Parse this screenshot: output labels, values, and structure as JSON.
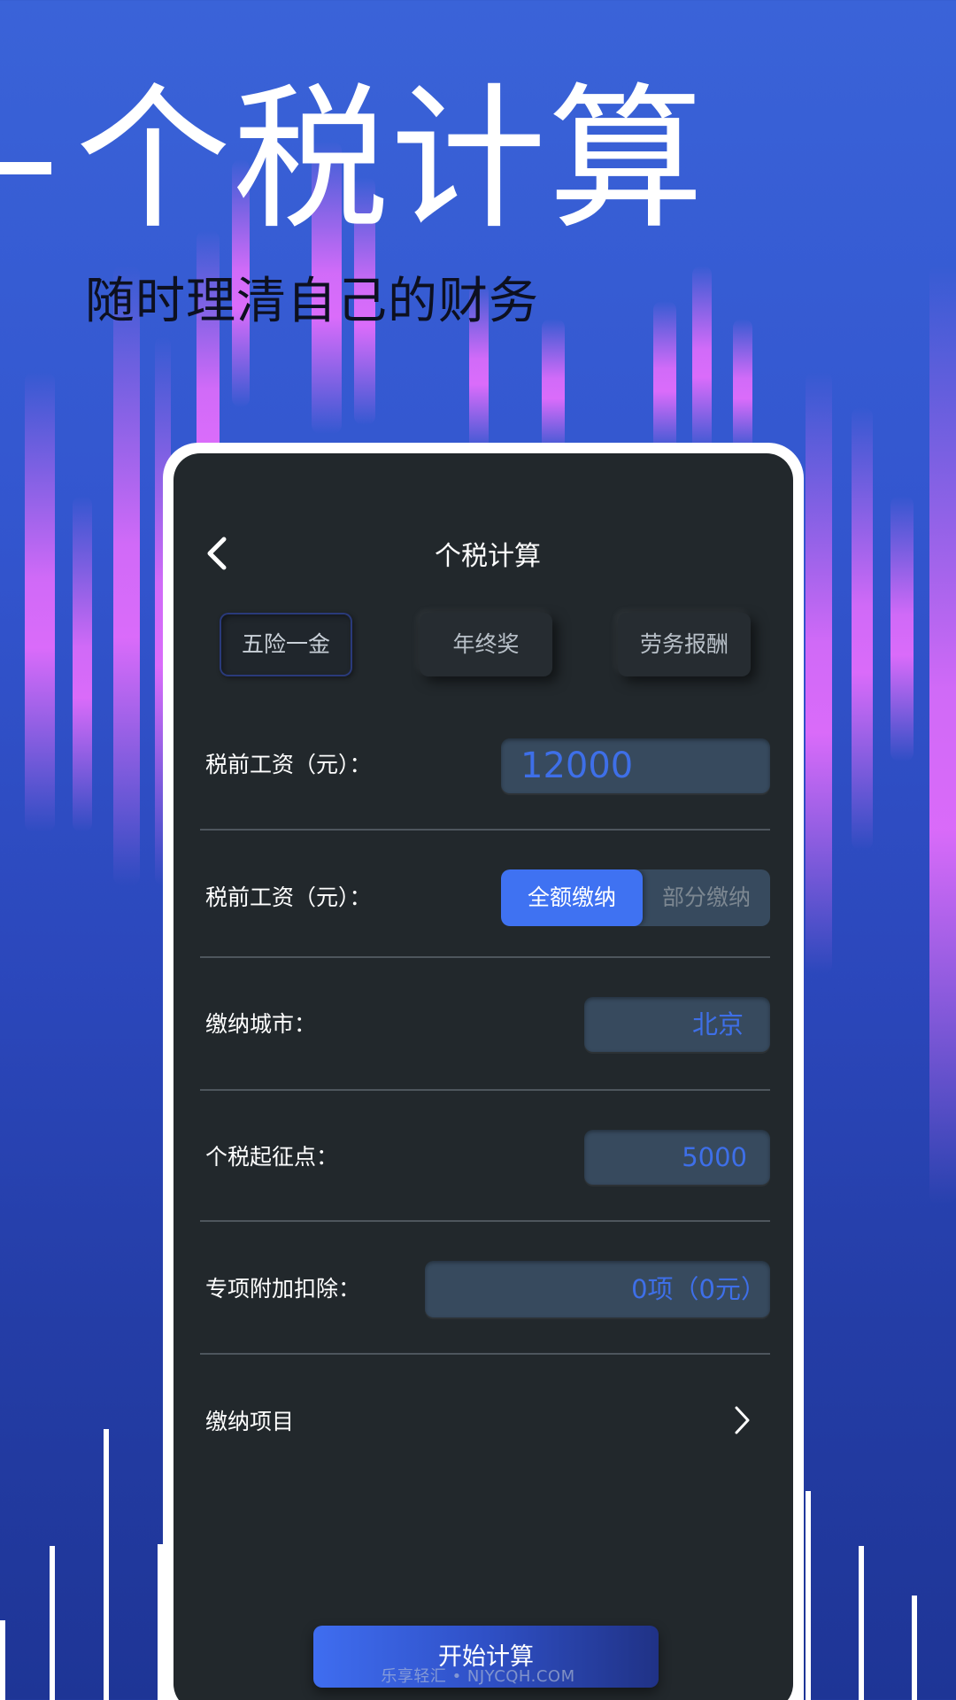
{
  "hero": {
    "title": "个税计算",
    "subtitle": "随时理清自己的财务"
  },
  "screen": {
    "title": "个税计算",
    "back_icon": "chevron-left-icon",
    "tabs": [
      {
        "label": "五险一金",
        "active": true
      },
      {
        "label": "年终奖",
        "active": false
      },
      {
        "label": "劳务报酬",
        "active": false
      }
    ],
    "rows": {
      "salary": {
        "label": "税前工资（元）：",
        "value": "12000"
      },
      "payment_mode": {
        "label": "税前工资（元）：",
        "options": [
          "全额缴纳",
          "部分缴纳"
        ],
        "selected": "全额缴纳"
      },
      "city": {
        "label": "缴纳城市：",
        "value": "北京"
      },
      "threshold": {
        "label": "个税起征点：",
        "value": "5000"
      },
      "special_deduction": {
        "label": "专项附加扣除：",
        "value": "0项（0元）"
      },
      "items": {
        "label": "缴纳项目",
        "icon": "chevron-right-icon"
      }
    },
    "start_button": "开始计算"
  },
  "watermark": "乐享轻汇 • NJYCQH.COM",
  "colors": {
    "background": "#3356cf",
    "accent": "#3f72f2",
    "glow": "#ec6eff",
    "screen": "#22282c",
    "field": "#374a5e",
    "field_text": "#3e6fe8"
  }
}
